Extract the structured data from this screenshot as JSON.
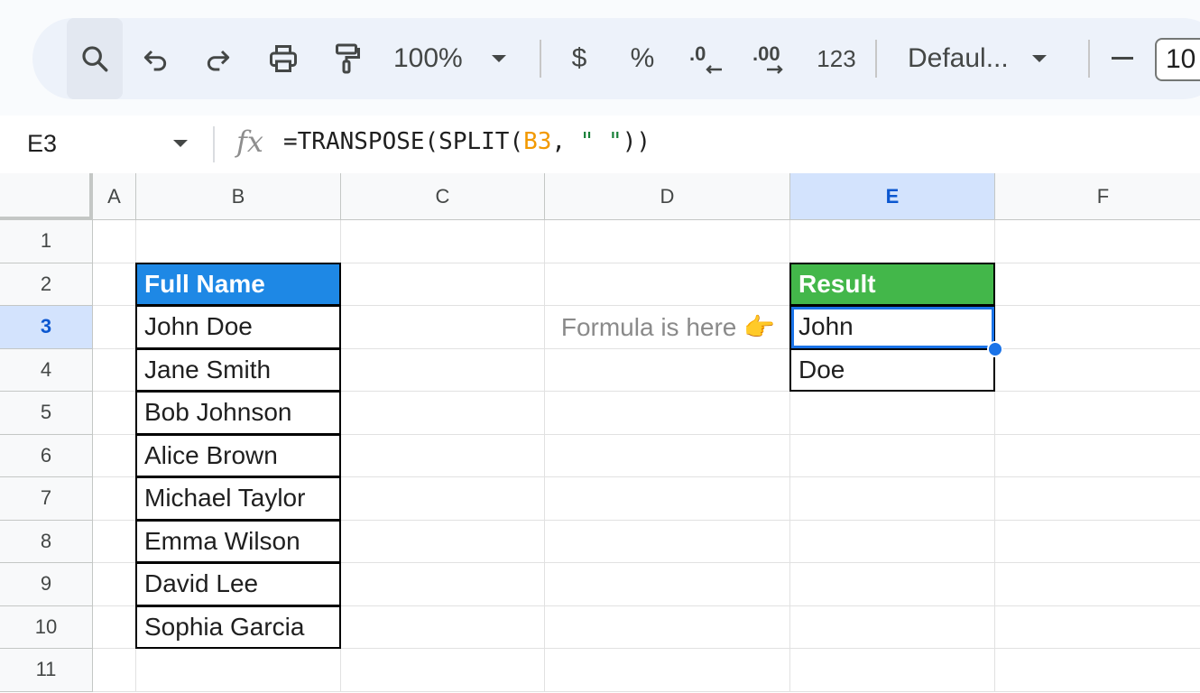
{
  "toolbar": {
    "zoom_label": "100%",
    "currency_label": "$",
    "percent_label": "%",
    "number_format_label": "123",
    "font_label": "Defaul...",
    "font_size_value": "10"
  },
  "formula_bar": {
    "cell_ref": "E3",
    "formula_parts": {
      "prefix": "=TRANSPOSE(SPLIT(",
      "ref": "B3",
      "mid": ", ",
      "string": "\" \"",
      "suffix": "))"
    }
  },
  "sheet": {
    "columns": [
      "A",
      "B",
      "C",
      "D",
      "E",
      "F"
    ],
    "rows": [
      "1",
      "2",
      "3",
      "4",
      "5",
      "6",
      "7",
      "8",
      "9",
      "10",
      "11"
    ],
    "selected_cell": {
      "column": "E",
      "row": "3"
    },
    "cells": {
      "B2": "Full Name",
      "B3": "John Doe",
      "B4": "Jane Smith",
      "B5": "Bob Johnson",
      "B6": "Alice Brown",
      "B7": "Michael Taylor",
      "B8": "Emma Wilson",
      "B9": "David Lee",
      "B10": "Sophia Garcia",
      "D3": "Formula is here 👉",
      "E2": "Result",
      "E3": "John",
      "E4": "Doe"
    },
    "colors": {
      "name_header_bg": "#1e88e5",
      "result_header_bg": "#43b74a",
      "selection": "#1a73e8"
    }
  }
}
